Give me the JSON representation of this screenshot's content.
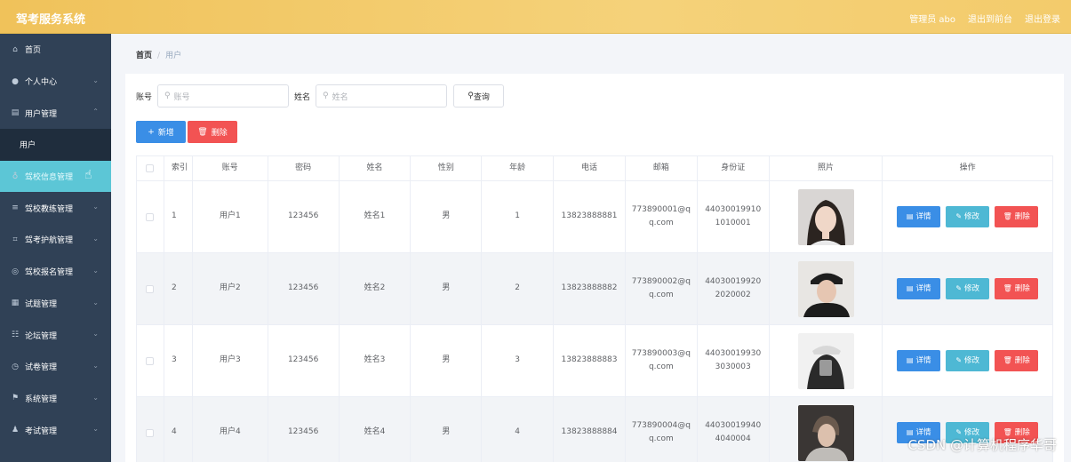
{
  "app": {
    "title": "驾考服务系统"
  },
  "header": {
    "admin_label": "管理员 abo",
    "back_to_front": "退出到前台",
    "logout": "退出登录"
  },
  "sidebar": {
    "items": [
      {
        "label": "首页",
        "icon": "home-icon"
      },
      {
        "label": "个人中心",
        "icon": "user-icon"
      },
      {
        "label": "用户管理",
        "icon": "list-icon"
      },
      {
        "label": "用户",
        "icon": ""
      },
      {
        "label": "驾校信息管理",
        "icon": "mic-icon"
      },
      {
        "label": "驾校教练管理",
        "icon": "menu-icon"
      },
      {
        "label": "驾考护航管理",
        "icon": "crop-icon"
      },
      {
        "label": "驾校报名管理",
        "icon": "globe-icon"
      },
      {
        "label": "试题管理",
        "icon": "doc-icon"
      },
      {
        "label": "论坛管理",
        "icon": "sliders-icon"
      },
      {
        "label": "试卷管理",
        "icon": "clock-icon"
      },
      {
        "label": "系统管理",
        "icon": "flag-icon"
      },
      {
        "label": "考试管理",
        "icon": "person-icon"
      }
    ]
  },
  "breadcrumb": {
    "home": "首页",
    "sep": "/",
    "current": "用户"
  },
  "search": {
    "account_label": "账号",
    "account_placeholder": "账号",
    "name_label": "姓名",
    "name_placeholder": "姓名",
    "query_button": "查询"
  },
  "toolbar": {
    "add_label": "新增",
    "delete_label": "删除"
  },
  "table": {
    "headers": [
      "索引",
      "账号",
      "密码",
      "姓名",
      "性别",
      "年龄",
      "电话",
      "邮箱",
      "身份证",
      "照片",
      "操作"
    ],
    "rows": [
      {
        "index": "1",
        "account": "用户1",
        "password": "123456",
        "name": "姓名1",
        "gender": "男",
        "age": "1",
        "phone": "13823888881",
        "email": "773890001@qq.com",
        "id_card": "440300199101010001"
      },
      {
        "index": "2",
        "account": "用户2",
        "password": "123456",
        "name": "姓名2",
        "gender": "男",
        "age": "2",
        "phone": "13823888882",
        "email": "773890002@qq.com",
        "id_card": "440300199202020002"
      },
      {
        "index": "3",
        "account": "用户3",
        "password": "123456",
        "name": "姓名3",
        "gender": "男",
        "age": "3",
        "phone": "13823888883",
        "email": "773890003@qq.com",
        "id_card": "440300199303030003"
      },
      {
        "index": "4",
        "account": "用户4",
        "password": "123456",
        "name": "姓名4",
        "gender": "男",
        "age": "4",
        "phone": "13823888884",
        "email": "773890004@qq.com",
        "id_card": "440300199404040004"
      }
    ],
    "row_actions": {
      "detail": "详情",
      "edit": "修改",
      "remove": "删除"
    }
  },
  "watermark": "CSDN @计算机程序华哥",
  "colors": {
    "header": "#f0c25a",
    "sidebar": "#304156",
    "active": "#5cc6d6",
    "primary": "#3a8ee6",
    "danger": "#f25353",
    "info": "#4eb8d4"
  }
}
